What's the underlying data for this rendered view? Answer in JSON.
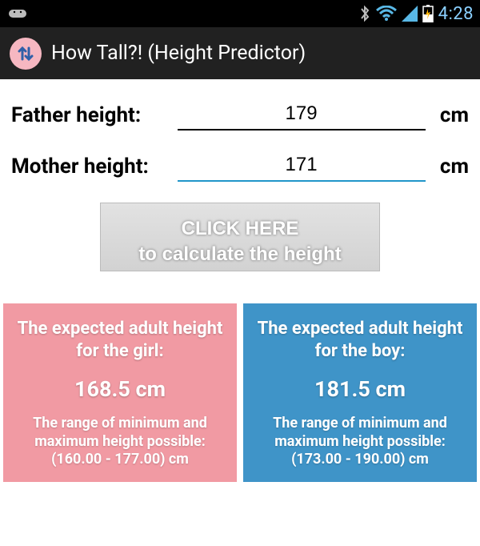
{
  "status": {
    "clock": "4:28"
  },
  "app": {
    "title": "How Tall?! (Height Predictor)"
  },
  "form": {
    "father_label": "Father height:",
    "father_value": "179",
    "mother_label": "Mother height:",
    "mother_value": "171",
    "unit": "cm",
    "button_line1": "CLICK HERE",
    "button_line2": "to calculate the height"
  },
  "results": {
    "girl": {
      "lead": "The expected adult height for the girl:",
      "value": "168.5 cm",
      "sub1": "The range of minimum and maximum height possible:",
      "sub2": "(160.00 - 177.00) cm"
    },
    "boy": {
      "lead": "The expected adult height for the boy:",
      "value": "181.5 cm",
      "sub1": "The range of minimum and maximum height possible:",
      "sub2": "(173.00 - 190.00) cm"
    }
  }
}
